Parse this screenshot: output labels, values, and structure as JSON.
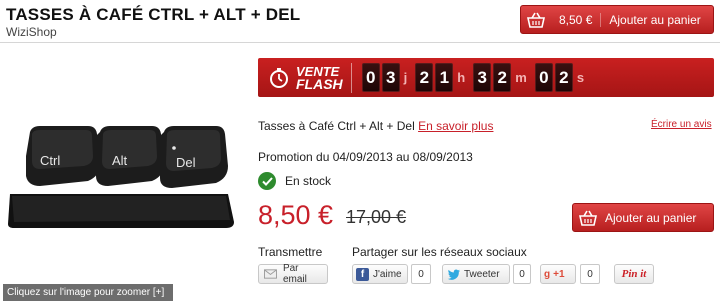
{
  "header": {
    "title": "TASSES À CAFÉ CTRL + ALT + DEL",
    "shop": "WiziShop",
    "cart_price": "8,50 €",
    "add_to_cart": "Ajouter au panier"
  },
  "image": {
    "keys": [
      "Ctrl",
      "Alt",
      "Del"
    ],
    "zoom_hint": "Cliquez sur l'image pour zoomer [+]"
  },
  "flash": {
    "line1": "VENTE",
    "line2": "FLASH",
    "days": [
      "0",
      "3"
    ],
    "hours": [
      "2",
      "1"
    ],
    "minutes": [
      "3",
      "2"
    ],
    "seconds": [
      "0",
      "2"
    ],
    "unit_days": "j",
    "unit_hours": "h",
    "unit_minutes": "m",
    "unit_seconds": "s"
  },
  "product": {
    "name": "Tasses à Café Ctrl + Alt + Del",
    "more_link": "En savoir plus",
    "review_link": "Écrire un avis",
    "promo": "Promotion du 04/09/2013 au 08/09/2013",
    "stock": "En stock",
    "price": "8,50 €",
    "old_price": "17,00 €",
    "add_to_cart": "Ajouter au panier"
  },
  "share": {
    "transmit_label": "Transmettre",
    "email_label": "Par email",
    "social_label": "Partager sur les réseaux sociaux",
    "facebook_label": "J'aime",
    "facebook_count": "0",
    "twitter_label": "Tweeter",
    "twitter_count": "0",
    "gplus_label": "+1",
    "gplus_count": "0",
    "pinterest_label": "Pin it"
  },
  "colors": {
    "accent_red": "#c8202a",
    "flash_bg": "#a51515",
    "stock_green": "#2e8b2e"
  }
}
